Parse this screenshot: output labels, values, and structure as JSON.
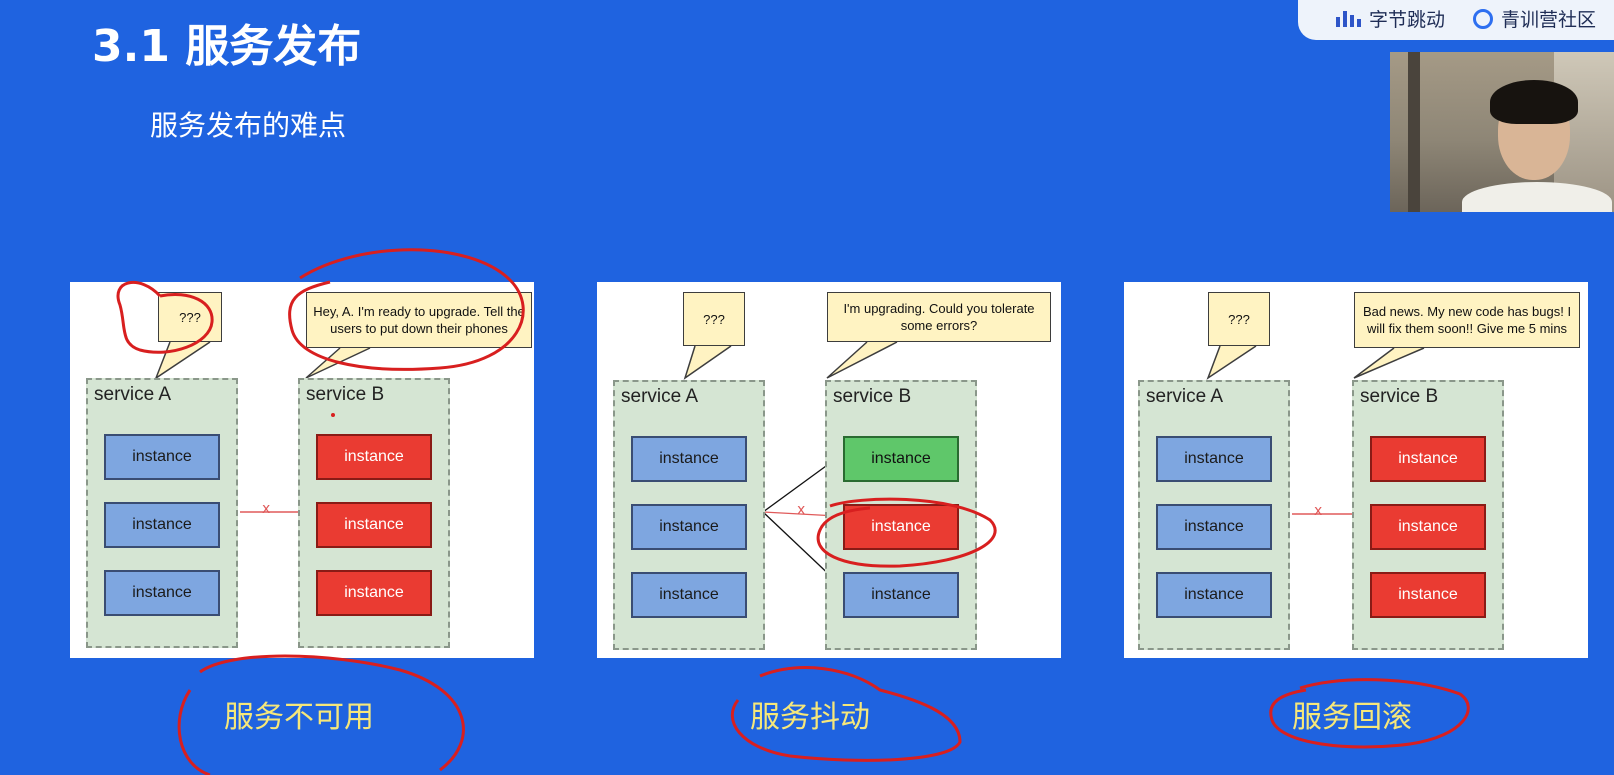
{
  "slide": {
    "title": "3.1 服务发布",
    "subtitle": "服务发布的难点"
  },
  "logo": {
    "brand_text": "字节跳动",
    "community_text": "青训营社区"
  },
  "panels": [
    {
      "caption": "服务不可用",
      "bubble_a": "???",
      "bubble_b": "Hey, A. I'm ready to upgrade. Tell the users to put down their phones",
      "service_a": {
        "label": "service A",
        "instances": [
          "instance",
          "instance",
          "instance"
        ]
      },
      "service_b": {
        "label": "service B",
        "instances": [
          "instance",
          "instance",
          "instance"
        ]
      },
      "arrow_mark": "x"
    },
    {
      "caption": "服务抖动",
      "bubble_a": "???",
      "bubble_b": "I'm upgrading. Could you tolerate some errors?",
      "service_a": {
        "label": "service A",
        "instances": [
          "instance",
          "instance",
          "instance"
        ]
      },
      "service_b": {
        "label": "service B",
        "instances": [
          "instance",
          "instance",
          "instance"
        ]
      },
      "arrow_mark": "x"
    },
    {
      "caption": "服务回滚",
      "bubble_a": "???",
      "bubble_b": "Bad news. My new code has bugs! I will fix them soon!! Give me 5 mins",
      "service_a": {
        "label": "service A",
        "instances": [
          "instance",
          "instance",
          "instance"
        ]
      },
      "service_b": {
        "label": "service B",
        "instances": [
          "instance",
          "instance",
          "instance"
        ]
      },
      "arrow_mark": "x"
    }
  ],
  "colors": {
    "background": "#1f63e0",
    "instance_ok": "#7ea6e0",
    "instance_down": "#ea3b32",
    "instance_upgraded": "#5fc76a",
    "caption": "#f6e77a",
    "annotation": "#d81f1f"
  }
}
